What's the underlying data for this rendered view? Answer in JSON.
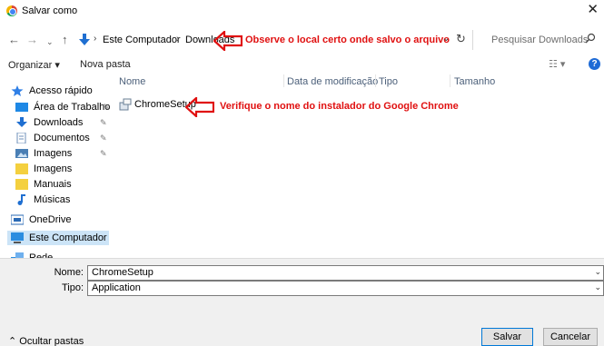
{
  "window": {
    "title": "Salvar como",
    "close_glyph": "✕"
  },
  "address_bar": {
    "crumbs": [
      "Este Computador",
      "Downloads"
    ],
    "separator": "›",
    "search_placeholder": "Pesquisar Downloads"
  },
  "annotations": {
    "location_note": "Observe o local certo onde salvo o arquivo",
    "file_note": "Verifique o nome do instalador do Google Chrome"
  },
  "toolbar": {
    "organize_label": "Organizar ▾",
    "new_folder_label": "Nova pasta",
    "view_label": "☷ ▾",
    "help_label": "?"
  },
  "sidebar": {
    "items": [
      {
        "label": "Acesso rápido",
        "icon": "star-icon"
      },
      {
        "label": "Área de Trabalho",
        "icon": "desktop-icon"
      },
      {
        "label": "Downloads",
        "icon": "download-icon"
      },
      {
        "label": "Documentos",
        "icon": "document-icon"
      },
      {
        "label": "Imagens",
        "icon": "pictures-icon"
      },
      {
        "label": "Imagens",
        "icon": "folder-icon"
      },
      {
        "label": "Manuais",
        "icon": "folder-icon"
      },
      {
        "label": "Músicas",
        "icon": "music-icon"
      },
      {
        "label": "OneDrive",
        "icon": "onedrive-icon"
      },
      {
        "label": "Este Computador",
        "icon": "computer-icon"
      },
      {
        "label": "Rede",
        "icon": "network-icon"
      }
    ]
  },
  "columns": [
    "Nome",
    "Data de modificação",
    "Tipo",
    "Tamanho"
  ],
  "files": [
    {
      "name": "ChromeSetup",
      "icon": "installer-icon"
    }
  ],
  "bottom": {
    "name_label": "Nome:",
    "name_value": "ChromeSetup",
    "type_label": "Tipo:",
    "type_value": "Application",
    "hide_folders_label": "Ocultar pastas",
    "save_label": "Salvar",
    "cancel_label": "Cancelar"
  },
  "colors": {
    "annotation": "#e01010",
    "selection": "#cce4f7",
    "accent": "#0078d7"
  }
}
